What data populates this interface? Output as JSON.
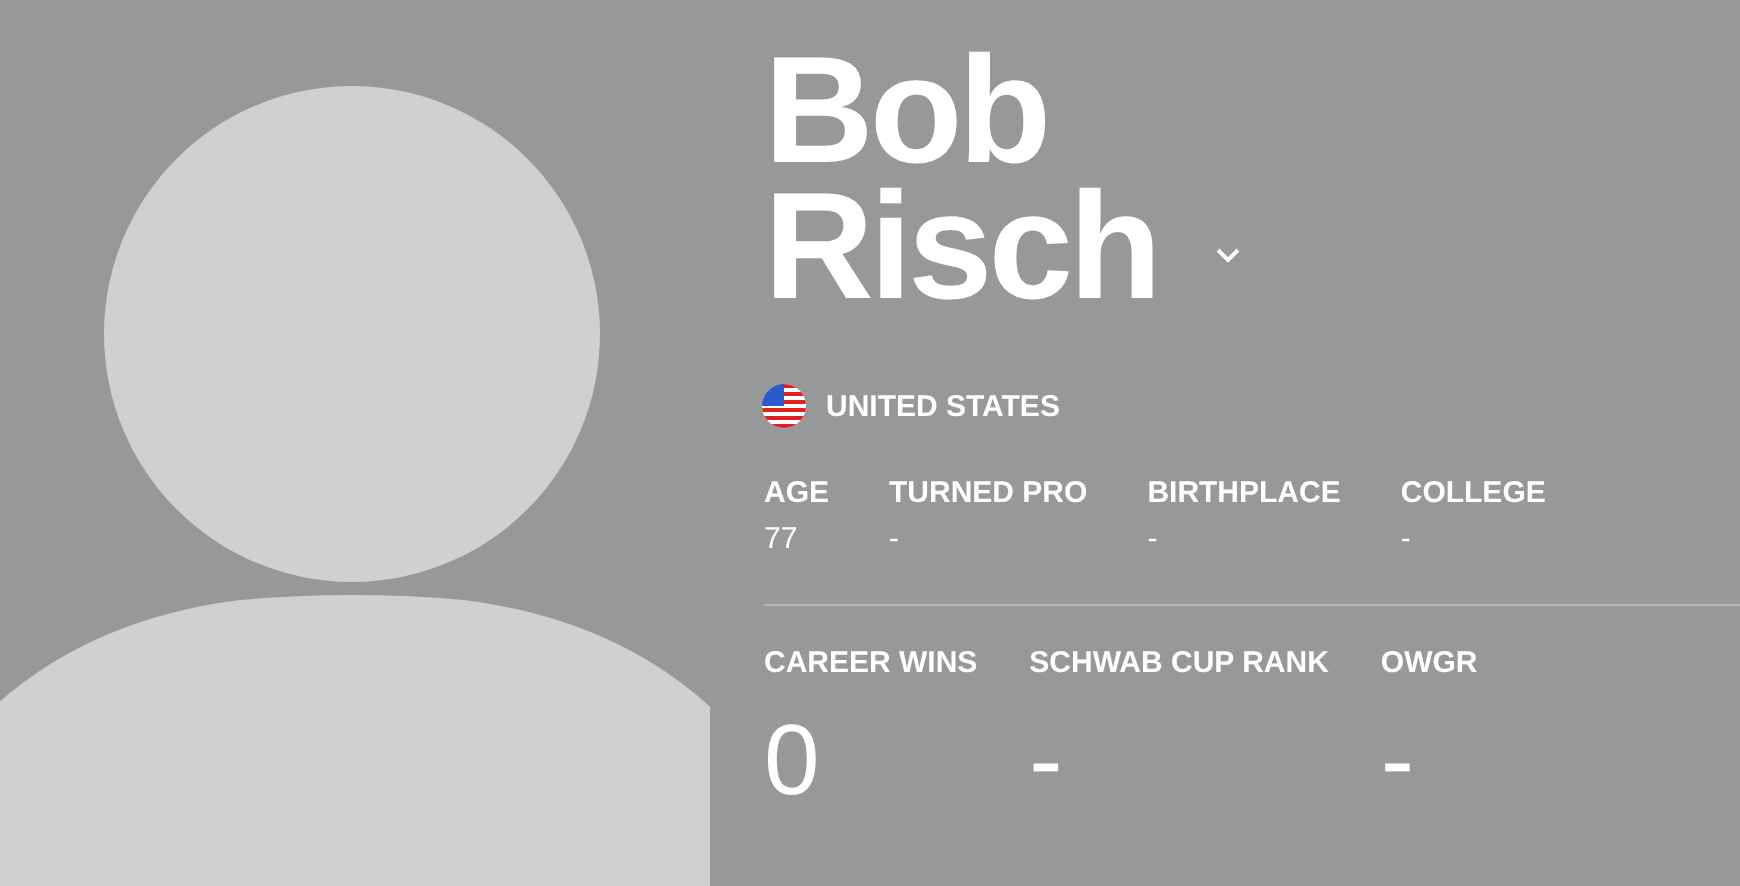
{
  "player": {
    "first_name": "Bob",
    "last_name": "Risch",
    "country": "UNITED STATES"
  },
  "bio": [
    {
      "label": "AGE",
      "value": "77"
    },
    {
      "label": "TURNED PRO",
      "value": "-"
    },
    {
      "label": "BIRTHPLACE",
      "value": "-"
    },
    {
      "label": "COLLEGE",
      "value": "-"
    }
  ],
  "stats": [
    {
      "label": "CAREER WINS",
      "value": "0"
    },
    {
      "label": "SCHWAB CUP RANK",
      "value": "-"
    },
    {
      "label": "OWGR",
      "value": "-"
    }
  ]
}
